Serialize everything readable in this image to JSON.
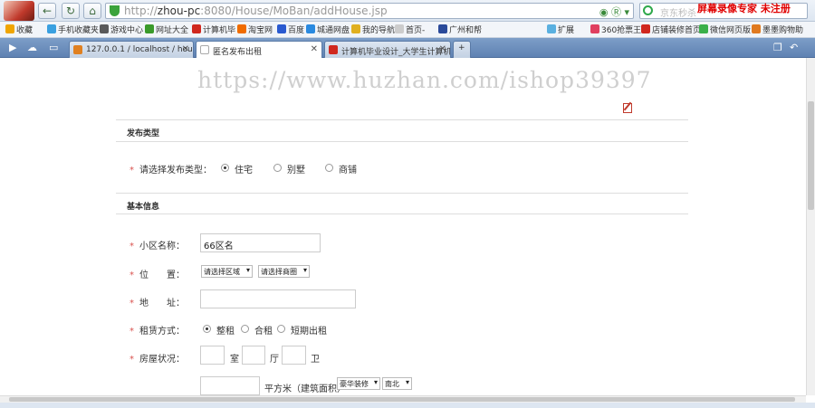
{
  "browser": {
    "url_prefix": "http://",
    "url_host": "zhou-pc",
    "url_rest": ":8080/House/MoBan/addHouse.jsp",
    "search_placeholder": "京东秒杀",
    "recording_watermark": "屏幕录像专家 未注册"
  },
  "bookmarks": [
    {
      "label": "收藏",
      "color": "#f0a500"
    },
    {
      "label": "手机收藏夹",
      "color": "#3aa0e0"
    },
    {
      "label": "游戏中心",
      "color": "#5a5a5a"
    },
    {
      "label": "网址大全",
      "color": "#3a9a2a"
    },
    {
      "label": "计算机毕",
      "color": "#d0281e"
    },
    {
      "label": "淘宝网",
      "color": "#f06c00"
    },
    {
      "label": "百度",
      "color": "#2a5ad0"
    },
    {
      "label": "城通网盘",
      "color": "#2a8ae0"
    },
    {
      "label": "我的导航",
      "color": "#e0b020"
    },
    {
      "label": "首页-",
      "color": "#ccc"
    },
    {
      "label": "广州和帮",
      "color": "#2a4a9a"
    },
    {
      "label": "扩展",
      "color": "#5ab0e0"
    },
    {
      "label": "360抢票王",
      "color": "#e04060"
    },
    {
      "label": "店铺装修首页",
      "color": "#d0281e"
    },
    {
      "label": "微信网页版",
      "color": "#3ab04a"
    },
    {
      "label": "墨墨购物助",
      "color": "#e07a20"
    }
  ],
  "tabs": [
    {
      "label": "127.0.0.1 / localhost / hous",
      "color": "#e08020"
    },
    {
      "label": "匿名发布出租",
      "color": "#dde"
    },
    {
      "label": "计算机毕业设计_大学生计算机",
      "color": "#d0281e"
    }
  ],
  "page": {
    "watermark": "https://www.huzhan.com/ishop39397",
    "section1_title": "发布类型",
    "publish_type_label": "请选择发布类型：",
    "publish_types": [
      "住宅",
      "别墅",
      "商铺"
    ],
    "section2_title": "基本信息",
    "community_label": "小区名称：",
    "community_value": "66区名",
    "location_label": "位　　置：",
    "region_select": "请选择区域",
    "business_select": "请选择商圈",
    "address_label": "地　　址：",
    "rent_label": "租赁方式：",
    "rent_options": [
      "整租",
      "合租",
      "短期出租"
    ],
    "house_label": "房屋状况：",
    "room_unit": "室",
    "hall_unit": "厅",
    "bath_unit": "卫",
    "area_unit": "平方米（建筑面积）",
    "decoration_select": "豪华装修",
    "direction_select": "南北"
  }
}
